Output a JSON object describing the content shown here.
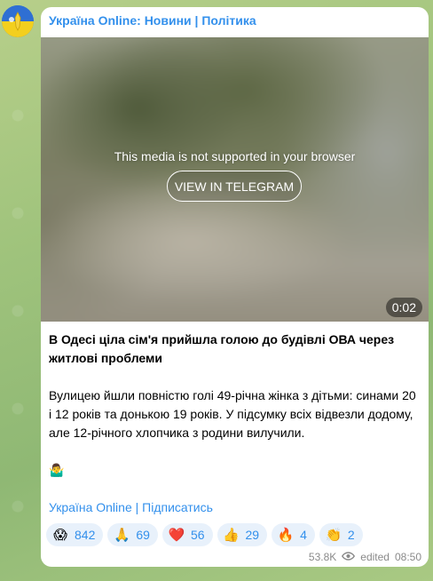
{
  "channel": {
    "name": "Україна Online: Новини | Політика"
  },
  "media": {
    "unsupported_message": "This media is not supported in your browser",
    "view_button_label": "VIEW IN TELEGRAM",
    "duration": "0:02"
  },
  "post": {
    "title": "В Одесі ціла сім'я прийшла голою до будівлі ОВА через житлові проблеми",
    "body": "Вулицею йшли повністю голі 49-річна жінка з дітьми: синами 20 і 12 років та донькою 19 років. У підсумку всіх відвезли додому, але 12-річного хлопчика з родини вилучили.",
    "emoji": "🤷‍♂️",
    "footer_link": "Україна Online | Підписатись"
  },
  "reactions": [
    {
      "emoji": "😱",
      "count": "842"
    },
    {
      "emoji": "🙏",
      "count": "69"
    },
    {
      "emoji": "❤️",
      "count": "56"
    },
    {
      "emoji": "👍",
      "count": "29"
    },
    {
      "emoji": "🔥",
      "count": "4"
    },
    {
      "emoji": "👏",
      "count": "2"
    }
  ],
  "meta": {
    "views": "53.8K",
    "edited_label": "edited",
    "time": "08:50"
  },
  "colors": {
    "accent": "#3390ec",
    "bubble": "#ffffff",
    "reaction_bg": "#e8f1fb",
    "meta_text": "#8a8a8a"
  },
  "icons": {
    "views": "eye-icon",
    "avatar": "channel-avatar"
  }
}
